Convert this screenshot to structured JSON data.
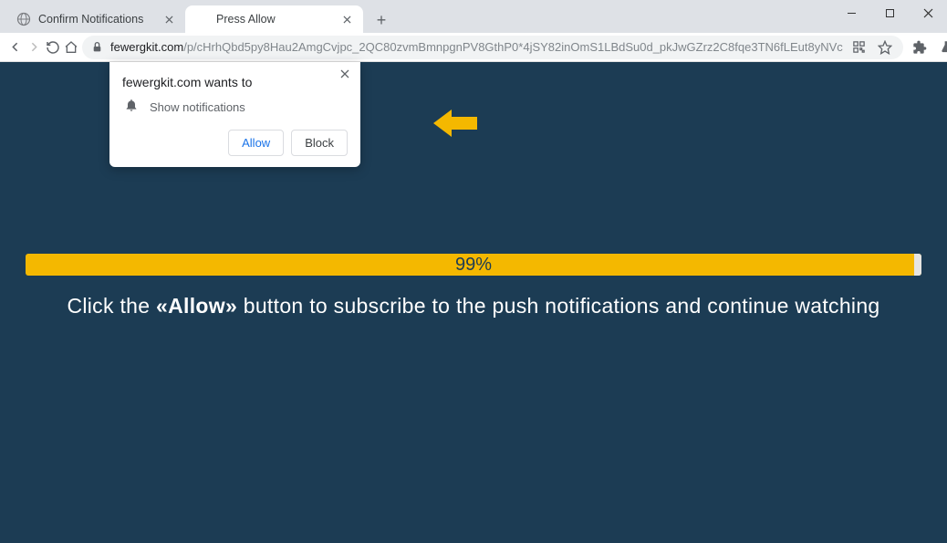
{
  "window": {
    "tabs": [
      {
        "title": "Confirm Notifications"
      },
      {
        "title": "Press Allow"
      }
    ],
    "active_tab_index": 1
  },
  "addressbar": {
    "host": "fewergkit.com",
    "path": "/p/cHrhQbd5py8Hau2AmgCvjpc_2QC80zvmBmnpgnPV8GthP0*4jSY82inOmS1LBdSu0d_pkJwGZrz2C8fqe3TN6fLEut8yNVc"
  },
  "notification_prompt": {
    "title": "fewergkit.com wants to",
    "permission_label": "Show notifications",
    "allow": "Allow",
    "block": "Block"
  },
  "page": {
    "progress": "99%",
    "cta_prefix": "Click the ",
    "cta_emphasis": "«Allow»",
    "cta_suffix": " button to subscribe to the push notifications and continue watching",
    "accent_color": "#f4b800",
    "bg_color": "#1c3c54"
  }
}
